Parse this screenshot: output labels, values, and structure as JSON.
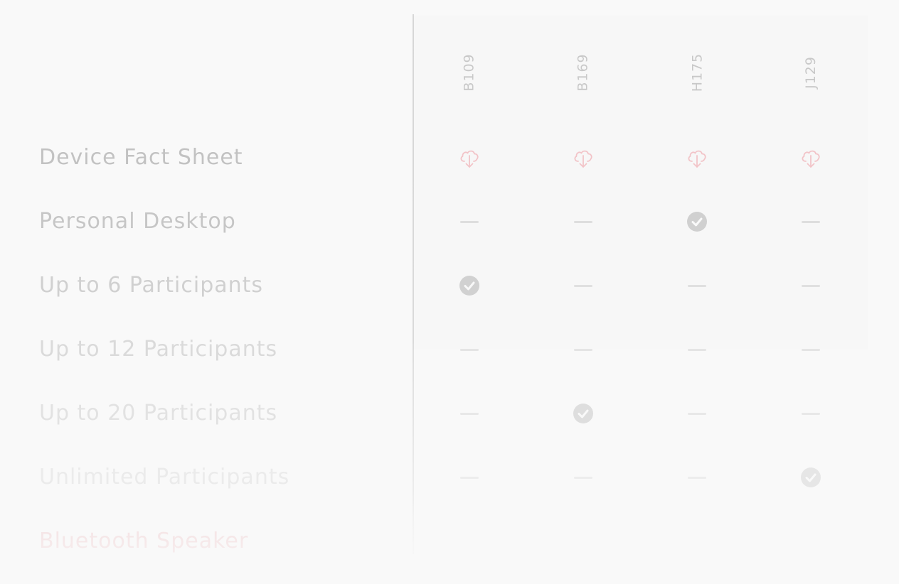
{
  "columns": [
    {
      "label": "B109"
    },
    {
      "label": "B169"
    },
    {
      "label": "H175"
    },
    {
      "label": "J129"
    }
  ],
  "rows": [
    {
      "label": "Device Fact Sheet",
      "type": "download",
      "cells": [
        "download",
        "download",
        "download",
        "download"
      ]
    },
    {
      "label": "Personal Desktop",
      "type": "feature",
      "cells": [
        "dash",
        "dash",
        "check",
        "dash"
      ]
    },
    {
      "label": "Up to 6 Participants",
      "type": "feature",
      "cells": [
        "check",
        "dash",
        "dash",
        "dash"
      ]
    },
    {
      "label": "Up to 12 Participants",
      "type": "feature",
      "cells": [
        "dash",
        "dash",
        "dash",
        "dash"
      ]
    },
    {
      "label": "Up to 20 Participants",
      "type": "feature",
      "cells": [
        "dash",
        "check",
        "dash",
        "dash"
      ]
    },
    {
      "label": "Unlimited Participants",
      "type": "feature",
      "cells": [
        "dash",
        "dash",
        "dash",
        "check"
      ]
    },
    {
      "label": "Bluetooth Speaker",
      "type": "feature",
      "cells": []
    }
  ],
  "icons": {
    "download": "cloud-download-icon",
    "check": "check-circle-icon",
    "dash": "dash-icon"
  },
  "colors": {
    "accent": "#f2c4c8",
    "label_text": "#c4c4c4",
    "check_fill": "#d0d0d0",
    "dash": "#dedede",
    "divider": "#d9d9d9"
  }
}
